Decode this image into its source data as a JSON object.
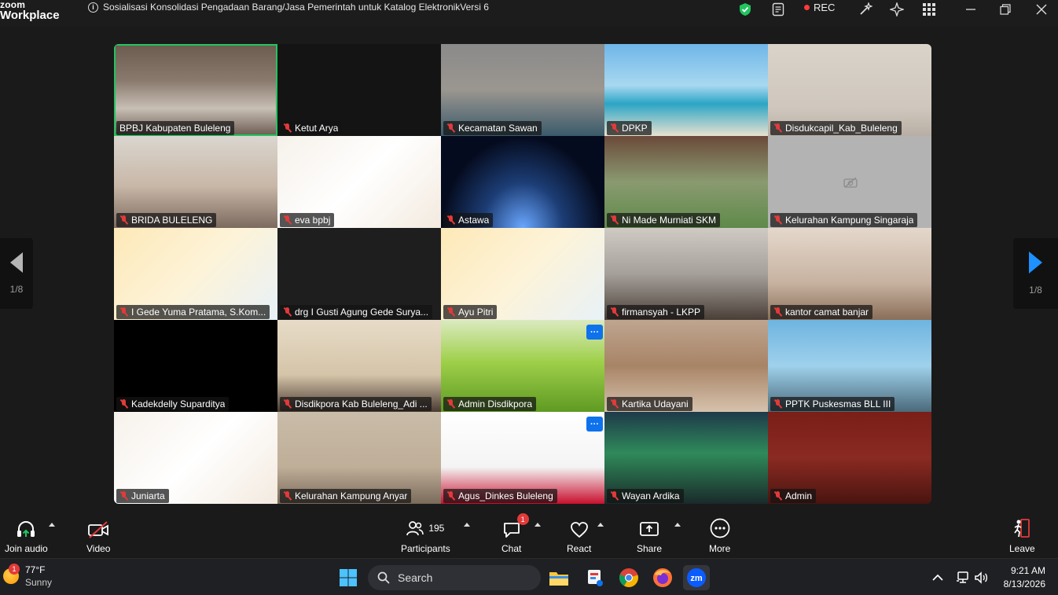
{
  "app": {
    "logo_line1": "zoom",
    "logo_line2": "Workplace",
    "meeting_title": "Sosialisasi Konsolidasi Pengadaan Barang/Jasa Pemerintah untuk Katalog ElektronikVersi 6",
    "rec_label": "REC"
  },
  "gallery": {
    "page_indicator_left": "1/8",
    "page_indicator_right": "1/8",
    "tiles": [
      {
        "name": "BPBJ Kabupaten Buleleng",
        "muted": false,
        "bg": "linear-gradient(180deg,#6b5a4e 0%,#8a7a6e 40%,#c8bfb5 70%,#6b5a50 100%)",
        "active": true
      },
      {
        "name": "Ketut Arya",
        "muted": true,
        "bg": "#141414"
      },
      {
        "name": "Kecamatan Sawan",
        "muted": true,
        "bg": "linear-gradient(180deg,#8a8a8a 0%,#9b9690 50%,#3a5a6a 100%)"
      },
      {
        "name": "DPKP",
        "muted": true,
        "bg": "linear-gradient(180deg,#6fb6e8 0%,#a8d8f0 45%,#2ca5c5 65%,#e8e2d0 100%)"
      },
      {
        "name": "Disdukcapil_Kab_Buleleng",
        "muted": true,
        "bg": "linear-gradient(180deg,#d9d3c9 0%,#cfc7bd 70%,#b8aea4 100%)"
      },
      {
        "name": "BRIDA BULELENG",
        "muted": true,
        "bg": "linear-gradient(180deg,#dad6cf 0%,#c8b7a7 55%,#7c6a5f 100%)"
      },
      {
        "name": "eva bpbj",
        "muted": true,
        "bg": "linear-gradient(135deg,#f6f1ea 0%,#ffffff 50%,#f3eadf 100%)"
      },
      {
        "name": "Astawa",
        "muted": true,
        "bg": "radial-gradient(ellipse at 50% 100%,#6aa7ff 0%,#1c3d75 35%,#050b1e 70%)"
      },
      {
        "name": "Ni Made Murniati SKM",
        "muted": true,
        "bg": "linear-gradient(180deg,#6b4a3a 0%,#8a9a70 50%,#5f8a4a 100%)"
      },
      {
        "name": "Kelurahan Kampung Singaraja",
        "muted": true,
        "bg": "#b3b3b3",
        "camoff": true
      },
      {
        "name": "I Gede Yuma Pratama, S.Kom...",
        "muted": true,
        "bg": "linear-gradient(135deg,#fde9b8 0%,#fdf3d8 50%,#e8f2f8 100%)"
      },
      {
        "name": "drg I Gusti Agung Gede Surya...",
        "muted": true,
        "bg": "#1e1e1e"
      },
      {
        "name": "Ayu Pitri",
        "muted": true,
        "bg": "linear-gradient(135deg,#fde9b8 0%,#fdf3d8 50%,#e8f2f8 100%)"
      },
      {
        "name": "firmansyah - LKPP",
        "muted": true,
        "bg": "linear-gradient(180deg,#cfcac4 0%,#a6a09a 50%,#4a3f38 100%)"
      },
      {
        "name": "kantor camat banjar",
        "muted": true,
        "bg": "linear-gradient(180deg,#e4d8cc 0%,#c7b2a0 60%,#8a6e5a 100%)"
      },
      {
        "name": "Kadekdelly Suparditya",
        "muted": true,
        "bg": "#000000"
      },
      {
        "name": "Disdikpora Kab Buleleng_Adi ...",
        "muted": true,
        "bg": "linear-gradient(180deg,#e8dcc8 0%,#d4c4a8 60%,#4a3a32 100%)"
      },
      {
        "name": "Admin Disdikpora",
        "muted": true,
        "bg": "linear-gradient(180deg,#dbeac0 0%,#9fd04a 45%,#5f9a22 100%)",
        "more": true
      },
      {
        "name": "Kartika Udayani",
        "muted": true,
        "bg": "linear-gradient(180deg,#bfa590 0%,#a88466 50%,#d6c2ad 100%)"
      },
      {
        "name": "PPTK Puskesmas BLL III",
        "muted": true,
        "bg": "linear-gradient(180deg,#6eb4e0 0%,#9fd1ec 50%,#4a6a7a 100%)"
      },
      {
        "name": "Juniarta",
        "muted": true,
        "bg": "linear-gradient(135deg,#f6f1ea 0%,#ffffff 50%,#f3eadf 100%)"
      },
      {
        "name": "Kelurahan Kampung Anyar",
        "muted": true,
        "bg": "linear-gradient(180deg,#c9bca8 0%,#bfae98 60%,#7a6a5a 100%)"
      },
      {
        "name": "Agus_Dinkes Buleleng",
        "muted": true,
        "bg": "linear-gradient(180deg,#ffffff 0%,#f4f4f4 60%,#c8102e 100%)",
        "more": true
      },
      {
        "name": "Wayan Ardika",
        "muted": true,
        "bg": "linear-gradient(180deg,#1e3a4a 0%,#2f8a5a 45%,#1a2a2a 100%)"
      },
      {
        "name": "Admin",
        "muted": true,
        "bg": "linear-gradient(180deg,#7a1e18 0%,#8a2a22 50%,#4a1410 100%)"
      }
    ]
  },
  "toolbar": {
    "join_audio": "Join audio",
    "video": "Video",
    "participants": "Participants",
    "participants_count": "195",
    "chat": "Chat",
    "chat_badge": "1",
    "react": "React",
    "share": "Share",
    "more": "More",
    "leave": "Leave"
  },
  "taskbar": {
    "weather_badge": "1",
    "temperature": "77°F",
    "condition": "Sunny",
    "search_placeholder": "Search",
    "time": "9:21 AM",
    "date": "8/13/2026"
  }
}
